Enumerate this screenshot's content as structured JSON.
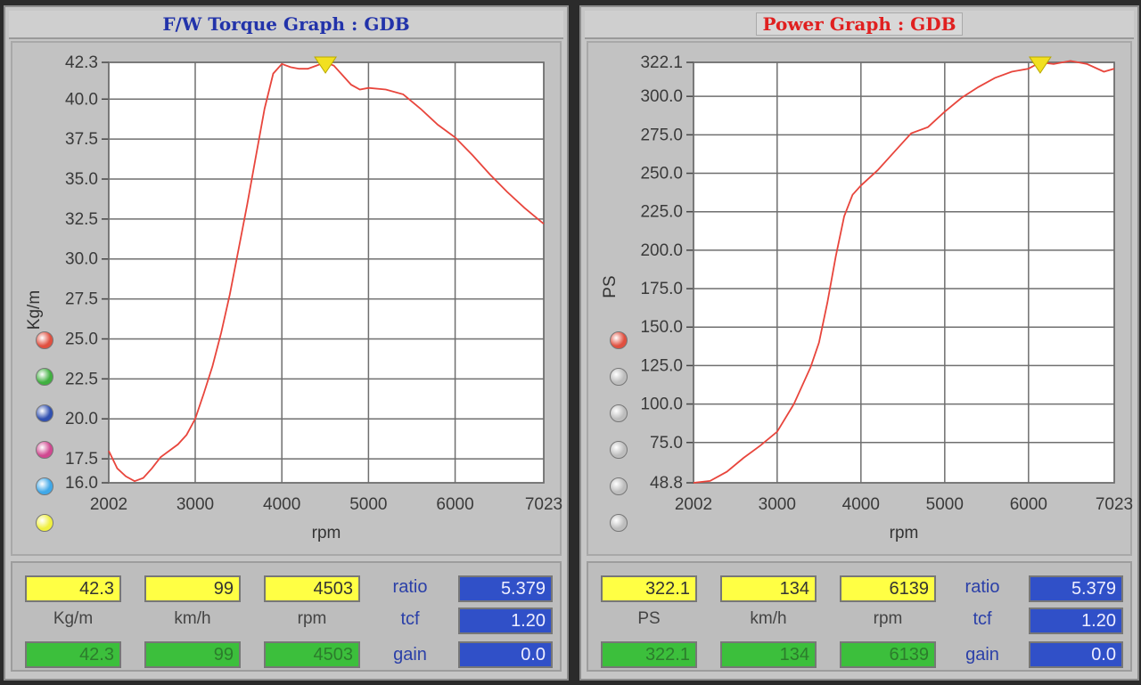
{
  "panels": [
    {
      "title": "F/W Torque Graph : GDB",
      "chart_data": {
        "type": "line",
        "title": "F/W Torque Graph : GDB",
        "xlabel": "rpm",
        "ylabel": "Kg/m",
        "xlim": [
          2002,
          7023
        ],
        "ylim": [
          16.0,
          42.3
        ],
        "x_ticks": [
          "2002",
          "3000",
          "4000",
          "5000",
          "6000",
          "7023"
        ],
        "y_ticks": [
          "42.3",
          "40.0",
          "37.5",
          "35.0",
          "32.5",
          "30.0",
          "27.5",
          "25.0",
          "22.5",
          "20.0",
          "17.5",
          "16.0"
        ],
        "grid": true,
        "series": [
          {
            "color": "#e8453c",
            "x": [
              2002,
              2100,
              2200,
              2300,
              2400,
              2500,
              2600,
              2700,
              2800,
              2900,
              3000,
              3100,
              3200,
              3300,
              3400,
              3500,
              3600,
              3700,
              3800,
              3900,
              4000,
              4100,
              4200,
              4300,
              4400,
              4500,
              4600,
              4700,
              4800,
              4900,
              5000,
              5200,
              5400,
              5600,
              5800,
              6000,
              6200,
              6400,
              6600,
              6800,
              7023
            ],
            "y": [
              18.0,
              16.9,
              16.4,
              16.1,
              16.3,
              16.9,
              17.6,
              18.0,
              18.4,
              19.0,
              20.0,
              21.6,
              23.3,
              25.4,
              27.8,
              30.6,
              33.4,
              36.4,
              39.4,
              41.6,
              42.2,
              42.0,
              41.9,
              41.9,
              42.1,
              42.3,
              42.1,
              41.5,
              40.9,
              40.6,
              40.7,
              40.6,
              40.3,
              39.4,
              38.4,
              37.6,
              36.5,
              35.3,
              34.2,
              33.2,
              32.2
            ]
          }
        ],
        "marker": {
          "x": 4503,
          "y": 42.3,
          "color": "#f2e020"
        }
      },
      "readout": {
        "top_values": [
          "42.3",
          "99",
          "4503"
        ],
        "units": [
          "Kg/m",
          "km/h",
          "rpm"
        ],
        "bottom_values": [
          "42.3",
          "99",
          "4503"
        ],
        "params": [
          {
            "label": "ratio",
            "value": "5.379"
          },
          {
            "label": "tcf",
            "value": "1.20"
          },
          {
            "label": "gain",
            "value": "0.0"
          }
        ]
      },
      "legend_dots": [
        "#e05040",
        "#40b040",
        "#3050b0",
        "#d04890",
        "#40a8e8",
        "#f0f040"
      ]
    },
    {
      "title": "Power Graph : GDB",
      "chart_data": {
        "type": "line",
        "title": "Power Graph : GDB",
        "xlabel": "rpm",
        "ylabel": "PS",
        "xlim": [
          2002,
          7023
        ],
        "ylim": [
          48.8,
          322.1
        ],
        "x_ticks": [
          "2002",
          "3000",
          "4000",
          "5000",
          "6000",
          "7023"
        ],
        "y_ticks": [
          "322.1",
          "300.0",
          "275.0",
          "250.0",
          "225.0",
          "200.0",
          "175.0",
          "150.0",
          "125.0",
          "100.0",
          "75.0",
          "48.8"
        ],
        "grid": true,
        "series": [
          {
            "color": "#e8453c",
            "x": [
              2002,
              2200,
              2400,
              2600,
              2800,
              3000,
              3200,
              3400,
              3500,
              3600,
              3700,
              3800,
              3900,
              4000,
              4200,
              4400,
              4600,
              4800,
              5000,
              5200,
              5400,
              5600,
              5800,
              6000,
              6139,
              6300,
              6500,
              6700,
              6900,
              7023
            ],
            "y": [
              48.8,
              50.0,
              56.0,
              65.0,
              73.0,
              82.0,
              100.0,
              124.0,
              140.0,
              166.0,
              196.0,
              222.0,
              236.0,
              242.0,
              252.0,
              264.0,
              276.0,
              280.0,
              290.0,
              299.0,
              306.0,
              312.0,
              316.0,
              318.0,
              322.1,
              321.0,
              323.0,
              321.0,
              316.0,
              318.0
            ]
          }
        ],
        "marker": {
          "x": 6139,
          "y": 322.1,
          "color": "#f2e020"
        }
      },
      "readout": {
        "top_values": [
          "322.1",
          "134",
          "6139"
        ],
        "units": [
          "PS",
          "km/h",
          "rpm"
        ],
        "bottom_values": [
          "322.1",
          "134",
          "6139"
        ],
        "params": [
          {
            "label": "ratio",
            "value": "5.379"
          },
          {
            "label": "tcf",
            "value": "1.20"
          },
          {
            "label": "gain",
            "value": "0.0"
          }
        ]
      },
      "legend_dots": [
        "#e05040",
        "#bdbdbd",
        "#bdbdbd",
        "#bdbdbd",
        "#bdbdbd",
        "#bdbdbd"
      ]
    }
  ]
}
